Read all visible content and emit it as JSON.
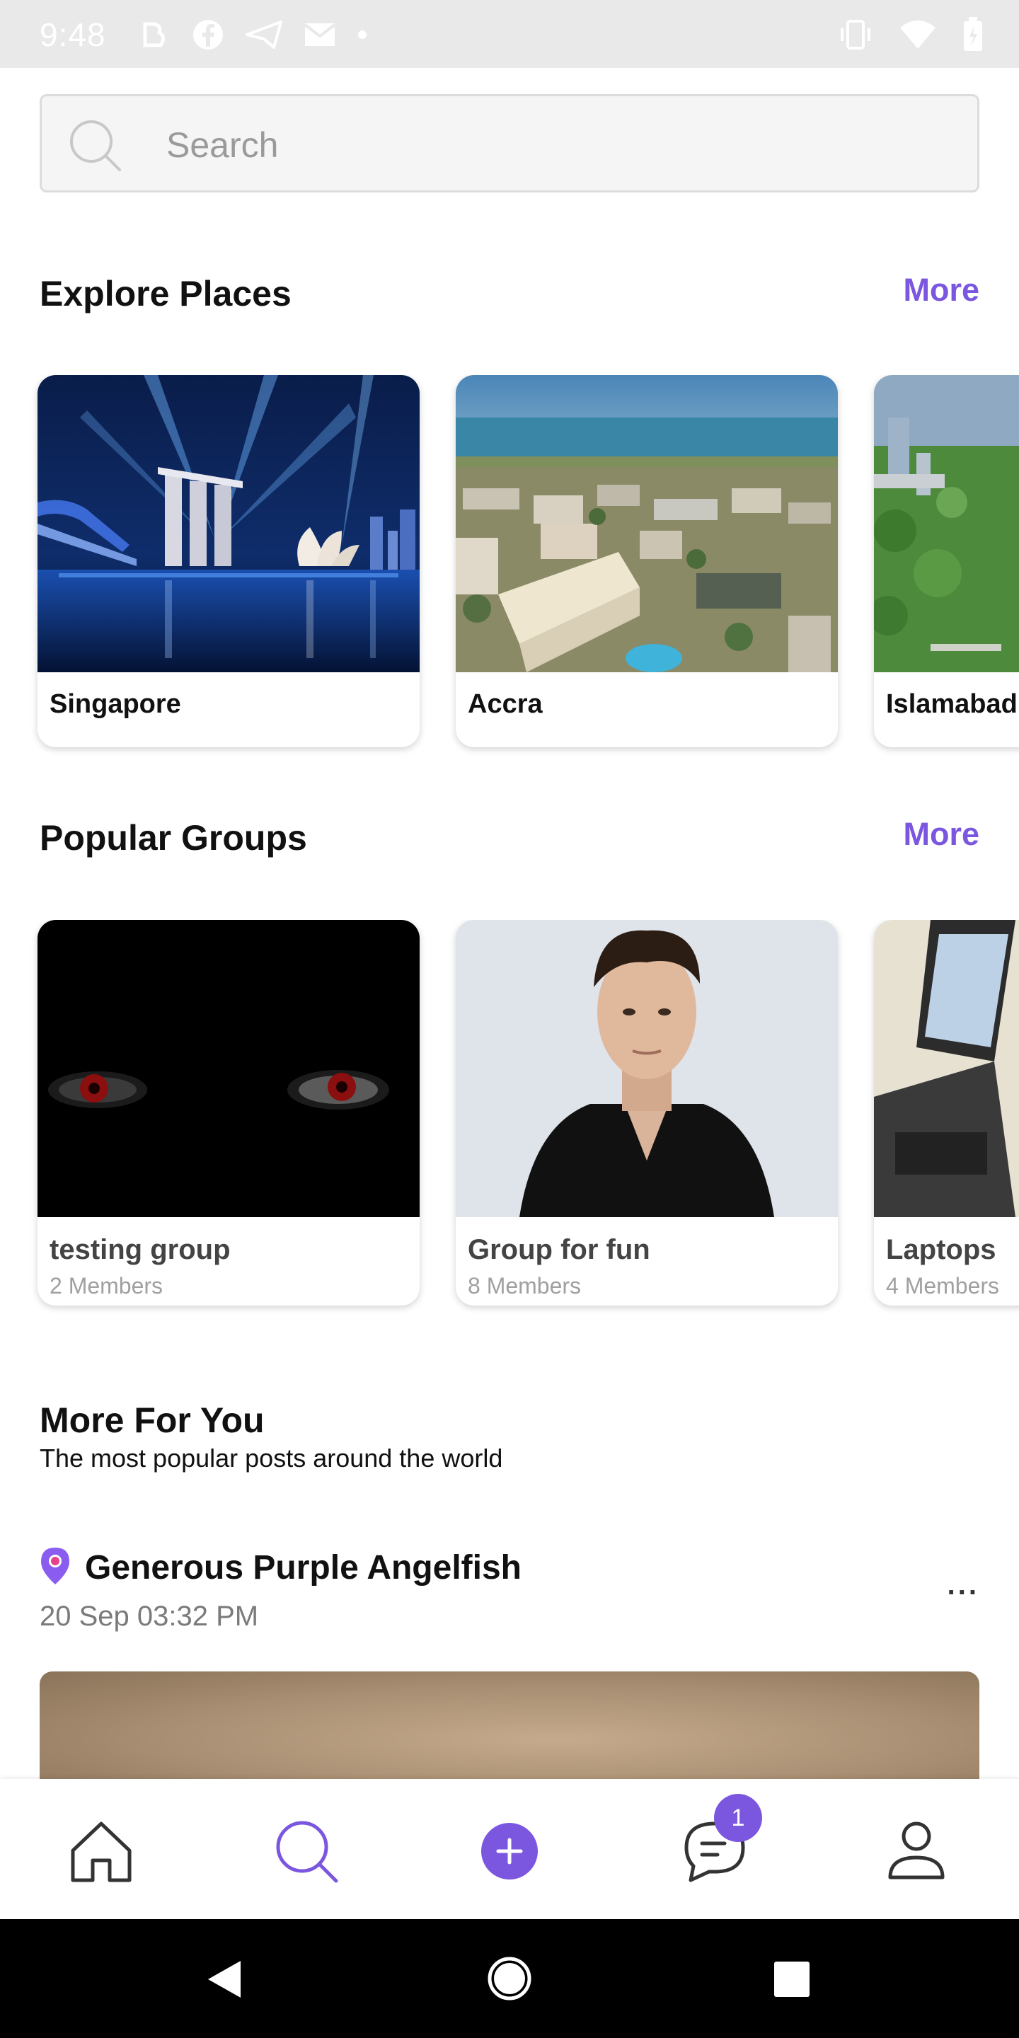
{
  "status_bar": {
    "time": "9:48"
  },
  "search": {
    "placeholder": "Search"
  },
  "explore": {
    "title": "Explore Places",
    "more": "More",
    "places": [
      {
        "name": "Singapore"
      },
      {
        "name": "Accra"
      },
      {
        "name": "Islamabad"
      }
    ]
  },
  "groups": {
    "title": "Popular Groups",
    "more": "More",
    "items": [
      {
        "name": "testing group",
        "members": "2 Members"
      },
      {
        "name": "Group for fun",
        "members": "8 Members"
      },
      {
        "name": "Laptops",
        "members": "4 Members"
      }
    ]
  },
  "more_for_you": {
    "title": "More For You",
    "subtitle": "The most popular posts around the world"
  },
  "post": {
    "author": "Generous Purple Angelfish",
    "date": "20 Sep 03:32 PM",
    "menu": "..."
  },
  "bottom_nav": {
    "items": [
      "home-icon",
      "search-icon",
      "add-icon",
      "chat-icon",
      "profile-icon"
    ],
    "chat_badge": "1",
    "accent": "#7b57e0"
  }
}
